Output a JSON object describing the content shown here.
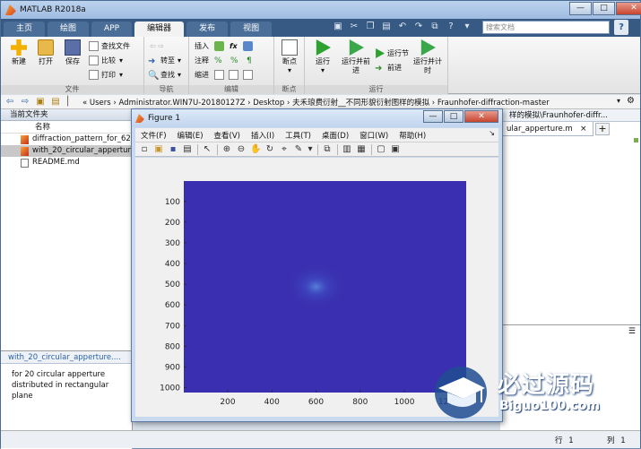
{
  "app": {
    "title": "MATLAB R2018a"
  },
  "window_controls": {
    "minimize": "—",
    "maximize": "□",
    "close": "✕"
  },
  "tabs": [
    {
      "label": "主页"
    },
    {
      "label": "绘图"
    },
    {
      "label": "APP"
    },
    {
      "label": "编辑器",
      "active": true
    },
    {
      "label": "发布"
    },
    {
      "label": "视图"
    }
  ],
  "search": {
    "placeholder": "搜索文档"
  },
  "ribbon": {
    "file_group": {
      "label": "文件",
      "new": "新建",
      "open": "打开",
      "save": "保存",
      "find_files": "查找文件",
      "compare": "比较",
      "print": "打印"
    },
    "nav_group": {
      "label": "导航",
      "goto": "转至",
      "find": "查找"
    },
    "edit_group": {
      "label": "编辑",
      "insert": "插入",
      "comment": "注释",
      "indent": "缩进",
      "fx": "fx"
    },
    "breakpoint_group": {
      "label": "断点",
      "breakpoints": "断点"
    },
    "run_group": {
      "label": "运行",
      "run": "运行",
      "run_advance": "运行并前进",
      "run_section": "运行节",
      "advance": "前进",
      "run_time": "运行并计时"
    }
  },
  "addressbar": {
    "path": "« Users › Administrator.WIN7U-20180127Z › Desktop › 夫禾琅费衍射__不同形貌衍射图样的模拟 › Fraunhofer-diffraction-master"
  },
  "current_folder": {
    "header": "当前文件夹",
    "column_name": "名称",
    "files": [
      {
        "name": "diffraction_pattern_for_62",
        "type": "m",
        "selected": false
      },
      {
        "name": "with_20_circular_apperture",
        "type": "m",
        "selected": true
      },
      {
        "name": "README.md",
        "type": "md",
        "selected": false
      }
    ]
  },
  "details": {
    "header": "with_20_circular_apperture....",
    "text_line1": "for 20 circular apperture",
    "text_line2": "distributed in rectangular plane"
  },
  "editor": {
    "path": "样的模拟\\Fraunhofer-diffr...",
    "tab_label": "ular_apperture.m",
    "tab_close": "×",
    "tab_add": "+"
  },
  "statusbar": {
    "line_label": "行",
    "line_value": "1",
    "col_label": "列",
    "col_value": "1"
  },
  "figure": {
    "title": "Figure 1",
    "menus": [
      "文件(F)",
      "编辑(E)",
      "查看(V)",
      "插入(I)",
      "工具(T)",
      "桌面(D)",
      "窗口(W)",
      "帮助(H)"
    ],
    "menu_arrow": "↘"
  },
  "chart_data": {
    "type": "heatmap",
    "title": "",
    "xlabel": "",
    "ylabel": "",
    "x_ticks": [
      200,
      400,
      600,
      800,
      1000,
      1200
    ],
    "y_ticks": [
      100,
      200,
      300,
      400,
      500,
      600,
      700,
      800,
      900,
      1000
    ],
    "x_range": [
      1,
      1280
    ],
    "y_range": [
      1,
      1024
    ],
    "y_reversed": true,
    "background_color": "#3a2fb0",
    "bright_spot_color": "#4a7bd8",
    "bright_spot_center": [
      600,
      512
    ],
    "grid": false,
    "legend": "none"
  },
  "watermark": {
    "title": "必过源码",
    "url": "Biguo100.com"
  }
}
